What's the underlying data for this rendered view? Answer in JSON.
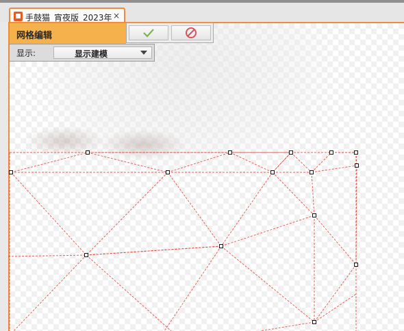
{
  "tab": {
    "title": "手鼓猫_宵夜版_2023年",
    "close": "×",
    "icon": "app-logo-icon"
  },
  "panel": {
    "title": "网格编辑",
    "confirm_icon": "checkmark-icon",
    "cancel_icon": "no-entry-icon",
    "display_label": "显示:",
    "display_value": "显示建模"
  },
  "colors": {
    "accent": "#f08a3c",
    "panel_header": "#f5b14c",
    "mesh_line": "#e8453c",
    "confirm": "#7ab648",
    "cancel": "#e0505a"
  }
}
